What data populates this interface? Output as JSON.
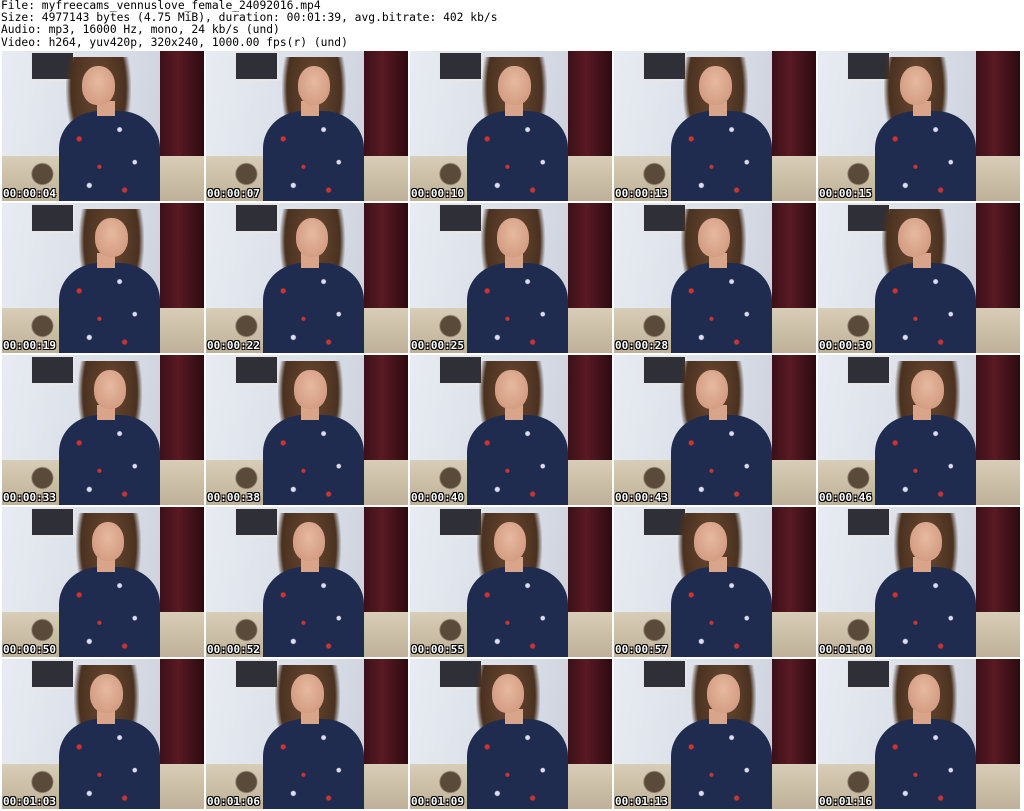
{
  "header": {
    "file_line": "File: myfreecams_vennuslove_female_24092016.mp4",
    "size_line": "Size: 4977143 bytes (4.75 MiB), duration: 00:01:39, avg.bitrate: 402 kb/s",
    "audio_line": "Audio: mp3, 16000 Hz, mono, 24 kb/s (und)",
    "video_line": "Video: h264, yuv420p, 320x240, 1000.00 fps(r) (und)"
  },
  "thumbnails": [
    {
      "timestamp": "00:00:04"
    },
    {
      "timestamp": "00:00:07"
    },
    {
      "timestamp": "00:00:10"
    },
    {
      "timestamp": "00:00:13"
    },
    {
      "timestamp": "00:00:15"
    },
    {
      "timestamp": "00:00:19"
    },
    {
      "timestamp": "00:00:22"
    },
    {
      "timestamp": "00:00:25"
    },
    {
      "timestamp": "00:00:28"
    },
    {
      "timestamp": "00:00:30"
    },
    {
      "timestamp": "00:00:33"
    },
    {
      "timestamp": "00:00:38"
    },
    {
      "timestamp": "00:00:40"
    },
    {
      "timestamp": "00:00:43"
    },
    {
      "timestamp": "00:00:46"
    },
    {
      "timestamp": "00:00:50"
    },
    {
      "timestamp": "00:00:52"
    },
    {
      "timestamp": "00:00:55"
    },
    {
      "timestamp": "00:00:57"
    },
    {
      "timestamp": "00:01:00"
    },
    {
      "timestamp": "00:01:03"
    },
    {
      "timestamp": "00:01:06"
    },
    {
      "timestamp": "00:01:09"
    },
    {
      "timestamp": "00:01:13"
    },
    {
      "timestamp": "00:01:16"
    }
  ]
}
